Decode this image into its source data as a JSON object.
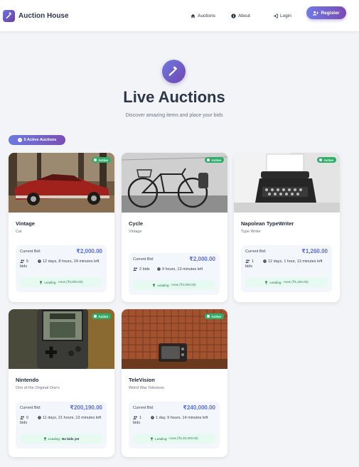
{
  "nav": {
    "brand": "Auction House",
    "links": [
      "Auctions",
      "About",
      "Login"
    ],
    "register": "Register"
  },
  "hero": {
    "title": "Live Auctions",
    "subtitle": "Discover amazing items and place your bids",
    "badge": "5 Active Auctions"
  },
  "labels": {
    "current_bid": "Current Bid:",
    "leading": "Leading:",
    "status": "Active"
  },
  "auctions": [
    {
      "title": "Vintage",
      "category": "Car",
      "bid": "₹2,000.00",
      "bids": "5 bids",
      "time": "12 days, 8 hours, 24 minutes left",
      "leading": "Anas (₹2,000.00)"
    },
    {
      "title": "Cycle",
      "category": "Vintage",
      "bid": "₹2,000.00",
      "bids": "2 bids",
      "time": "9 hours, 13 minutes left",
      "leading": "Anas (₹2,000.00)"
    },
    {
      "title": "Napolean TypeWriter",
      "category": "Type Writer",
      "bid": "₹1,260.00",
      "bids": "1 bids",
      "time": "12 days, 1 hour, 13 minutes left",
      "leading": "Anas (₹1,260.00)"
    },
    {
      "title": "Nintendo",
      "category": "One of the Original One's",
      "bid": "₹200,190.00",
      "bids": "0 bids",
      "time": "11 days, 21 hours, 13 minutes left",
      "leading": "No bids yet"
    },
    {
      "title": "TeleVision",
      "category": "Wolrd War Televison",
      "bid": "₹240,000.00",
      "bids": "1 bids",
      "time": "1 day, 9 hours, 14 minutes left",
      "leading": "Anas (₹2,40,000.00)"
    }
  ],
  "images": [
    "red vintage car in forest",
    "bicycle against wall",
    "vintage typewriter",
    "handheld Tetris game console",
    "retro television on wooden table"
  ],
  "colors": {
    "accent": "#6c7ae0",
    "accent2": "#7a4fb5",
    "price": "#5b6fd8",
    "active": "#2fae6a"
  }
}
